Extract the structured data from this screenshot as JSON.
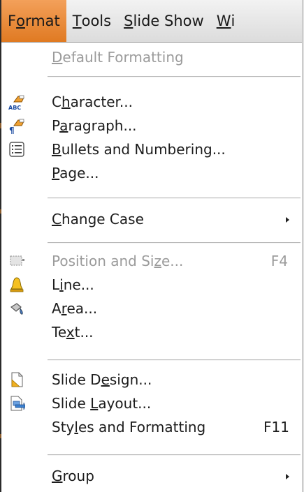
{
  "menubar": {
    "format": {
      "pre": "F",
      "ul": "o",
      "post": "rmat"
    },
    "tools": {
      "pre": "",
      "ul": "T",
      "post": "ools"
    },
    "slideshow": {
      "pre": "",
      "ul": "S",
      "post": "lide Show"
    },
    "window": {
      "pre": "",
      "ul": "W",
      "post": "i"
    }
  },
  "menu": {
    "default_formatting": {
      "pre": "",
      "ul": "D",
      "post": "efault Formatting"
    },
    "character": {
      "pre": "C",
      "ul": "h",
      "post": "aracter..."
    },
    "paragraph": {
      "pre": "P",
      "ul": "a",
      "post": "ragraph..."
    },
    "bullets": {
      "pre": "",
      "ul": "B",
      "post": "ullets and Numbering..."
    },
    "page": {
      "pre": "",
      "ul": "P",
      "post": "age..."
    },
    "change_case": {
      "pre": "",
      "ul": "C",
      "post": "hange Case"
    },
    "position_size": {
      "pre": "Position and Si",
      "ul": "z",
      "post": "e...",
      "shortcut": "F4"
    },
    "line": {
      "pre": "L",
      "ul": "i",
      "post": "ne..."
    },
    "area": {
      "pre": "A",
      "ul": "r",
      "post": "ea..."
    },
    "text": {
      "pre": "Te",
      "ul": "x",
      "post": "t..."
    },
    "slide_design": {
      "pre": "Slide D",
      "ul": "e",
      "post": "sign..."
    },
    "slide_layout": {
      "pre": "Slide ",
      "ul": "L",
      "post": "ayout..."
    },
    "styles": {
      "pre": "Sty",
      "ul": "l",
      "post": "es and Formatting",
      "shortcut": "F11"
    },
    "group": {
      "pre": "",
      "ul": "G",
      "post": "roup"
    }
  },
  "colors": {
    "menubar_active": "#e88a34",
    "disabled_text": "#9b9b9b"
  },
  "icons": {
    "character": "character-icon",
    "paragraph": "paragraph-icon",
    "bullets": "bullets-icon",
    "position_size": "position-size-icon",
    "line": "line-icon",
    "area": "area-icon",
    "slide_design": "slide-design-icon",
    "slide_layout": "slide-layout-icon"
  }
}
